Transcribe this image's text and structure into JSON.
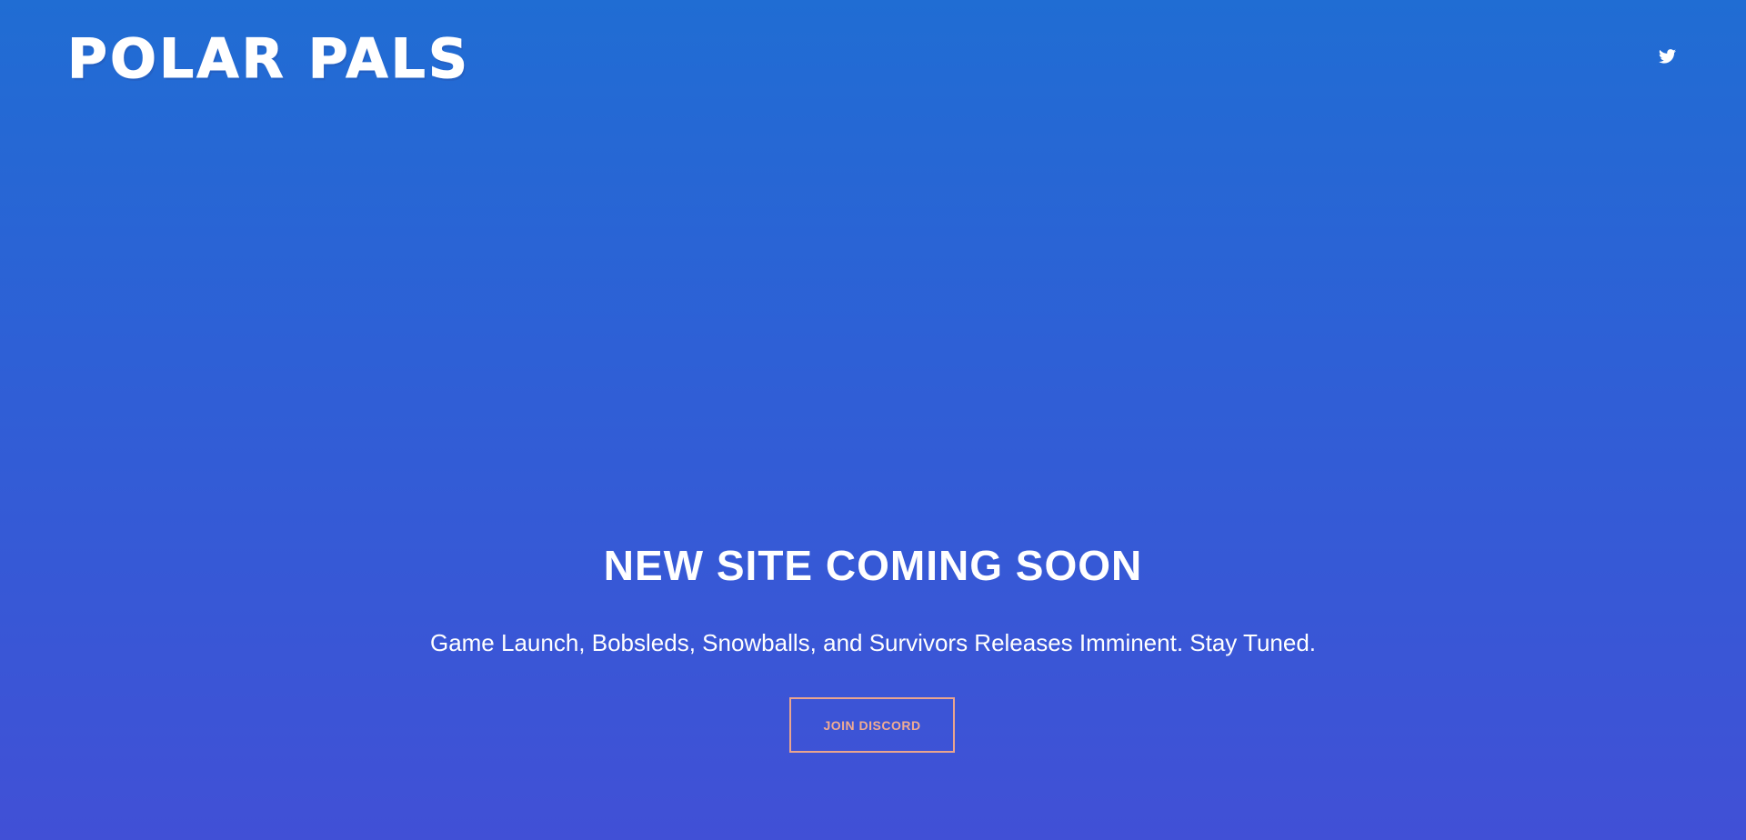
{
  "header": {
    "logo_text": "POLAR PALS",
    "social": {
      "twitter_icon": "twitter-bird-icon"
    }
  },
  "hero": {
    "headline": "NEW SITE COMING SOON",
    "subline": "Game Launch, Bobsleds, Snowballs, and Survivors Releases Imminent. Stay Tuned.",
    "cta_label": "JOIN DISCORD"
  },
  "colors": {
    "background_top": "#206dd3",
    "background_bottom": "#4150d6",
    "text": "#ffffff",
    "accent": "#f0ab92"
  }
}
